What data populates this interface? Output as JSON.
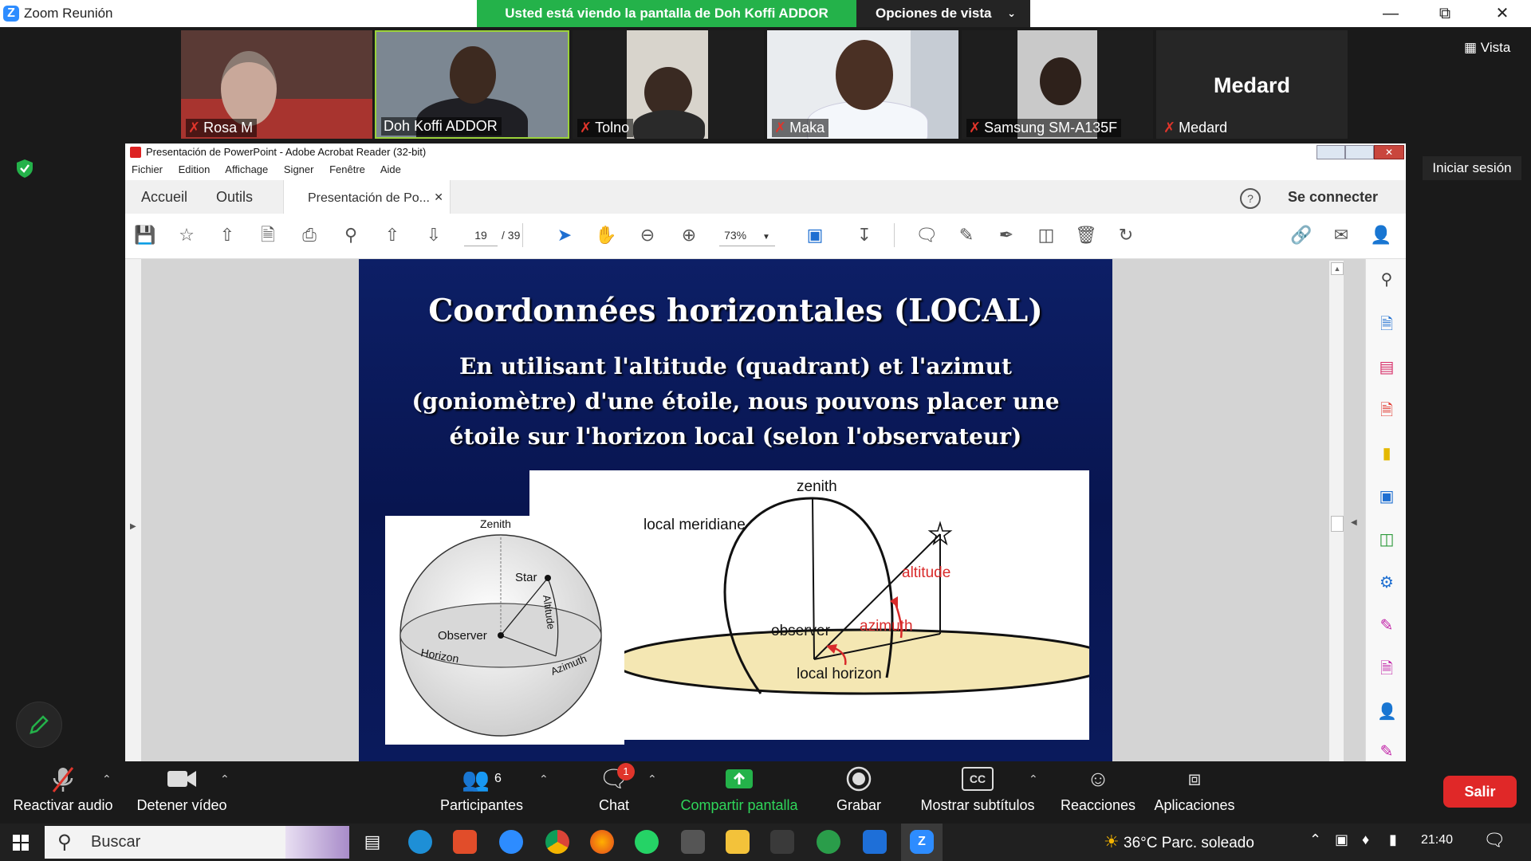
{
  "zoom": {
    "window_title": "Zoom Reunión",
    "sharing_banner": "Usted está viendo la pantalla de Doh Koffi ADDOR",
    "view_options": "Opciones de vista",
    "vista": "Vista",
    "iniciar_sesion": "Iniciar sesión",
    "participants": [
      {
        "name": "Rosa M",
        "muted": true
      },
      {
        "name": "Doh Koffi ADDOR",
        "muted": false
      },
      {
        "name": "Tolno",
        "muted": true
      },
      {
        "name": "Maka",
        "muted": true
      },
      {
        "name": "Samsung SM-A135F",
        "muted": true
      },
      {
        "name": "Medard",
        "muted": true
      }
    ],
    "medard_tile_label": "Medard",
    "controls": {
      "audio": "Reactivar audio",
      "video": "Detener vídeo",
      "participants": "Participantes",
      "participants_count": "6",
      "chat": "Chat",
      "chat_badge": "1",
      "share": "Compartir pantalla",
      "record": "Grabar",
      "subtitles": "Mostrar subtítulos",
      "reactions": "Reacciones",
      "apps": "Aplicaciones",
      "leave": "Salir"
    }
  },
  "acrobat": {
    "title": "Presentación de PowerPoint - Adobe Acrobat Reader (32-bit)",
    "menu": [
      "Fichier",
      "Edition",
      "Affichage",
      "Signer",
      "Fenêtre",
      "Aide"
    ],
    "tabs": {
      "home": "Accueil",
      "tools": "Outils",
      "doc": "Presentación de Po..."
    },
    "connect": "Se connecter",
    "page_current": "19",
    "page_total": "/ 39",
    "zoom": "73%"
  },
  "slide": {
    "title": "Coordonnées horizontales (LOCAL)",
    "subtitle_lines": [
      "En utilisant l'altitude (quadrant) et l'azimut",
      "(goniomètre) d'une étoile, nous pouvons placer une",
      "étoile sur l'horizon local (selon l'observateur)"
    ],
    "left_diagram": {
      "zenith": "Zenith",
      "star": "Star",
      "altitude": "Altitude",
      "observer": "Observer",
      "horizon": "Horizon",
      "azimuth": "Azimuth"
    },
    "right_diagram": {
      "zenith": "zenith",
      "meridian": "local meridiane",
      "altitude": "altitude",
      "observer": "observer",
      "azimuth": "azimuth",
      "horizon": "local horizon"
    }
  },
  "taskbar": {
    "search": "Buscar",
    "weather": "36°C  Parc. soleado",
    "time": "21:40"
  },
  "colors": {
    "zoom_green": "#24b24a",
    "salir_red": "#e02828",
    "slide_blue": "#0a1a5c",
    "diagram_red": "#d92a2a",
    "horizon_fill": "#f4e7b3"
  }
}
